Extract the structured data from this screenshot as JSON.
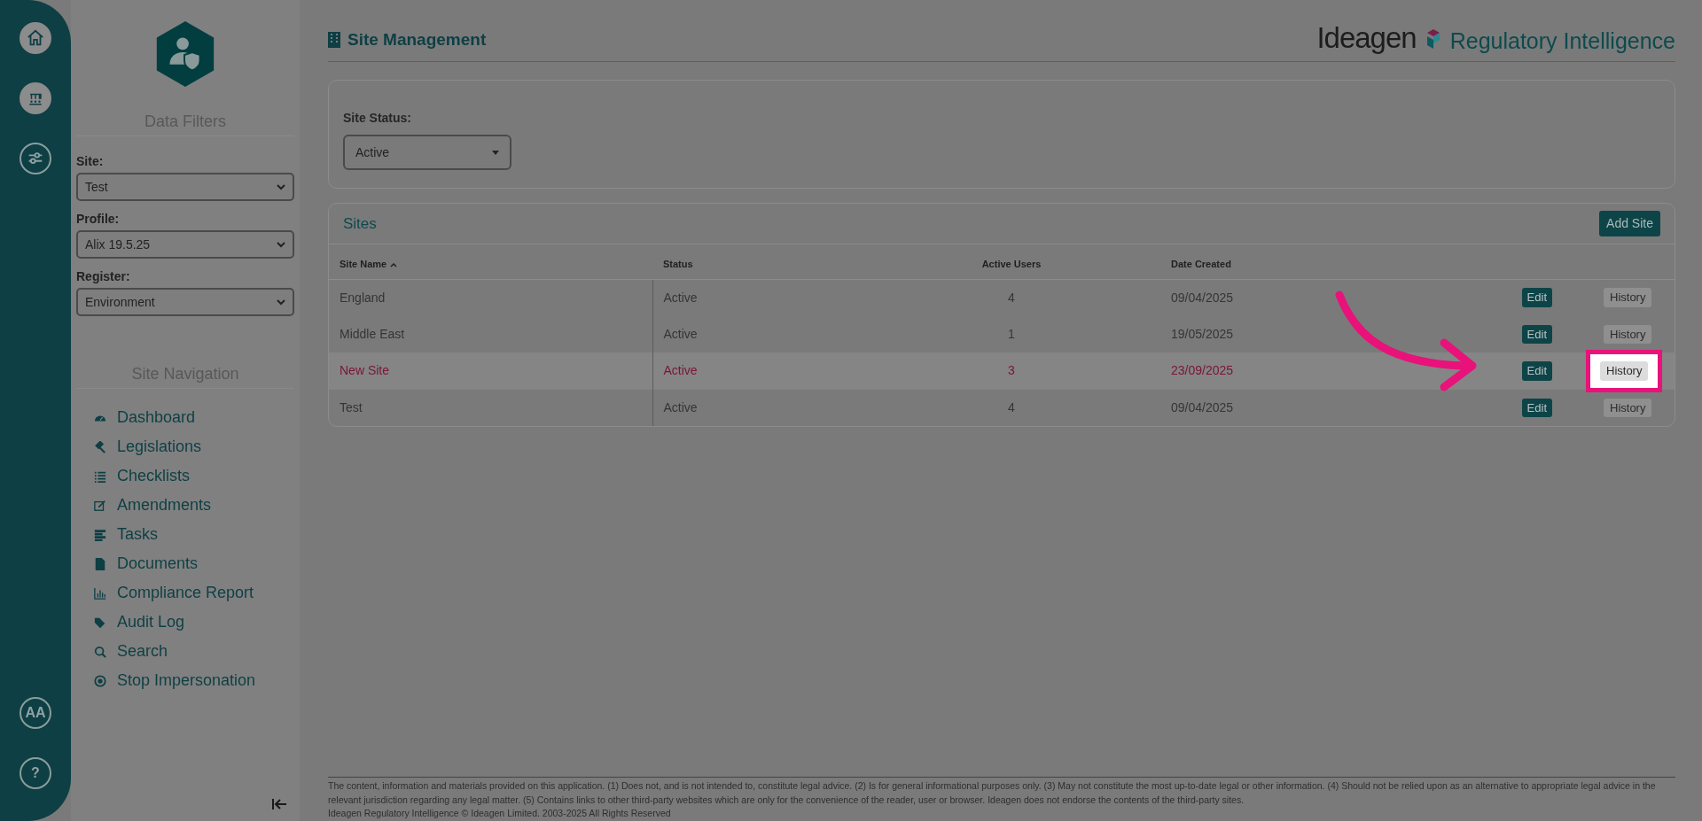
{
  "rail": {
    "avatar": "AA",
    "help": "?"
  },
  "sidebar": {
    "filters_title": "Data Filters",
    "filters": [
      {
        "label": "Site:",
        "value": "Test"
      },
      {
        "label": "Profile:",
        "value": "Alix 19.5.25"
      },
      {
        "label": "Register:",
        "value": "Environment"
      }
    ],
    "nav_title": "Site Navigation",
    "nav": [
      {
        "label": "Dashboard",
        "kind": "gauge"
      },
      {
        "label": "Legislations",
        "kind": "gavel"
      },
      {
        "label": "Checklists",
        "kind": "list"
      },
      {
        "label": "Amendments",
        "kind": "edit"
      },
      {
        "label": "Tasks",
        "kind": "tasks"
      },
      {
        "label": "Documents",
        "kind": "file"
      },
      {
        "label": "Compliance Report",
        "kind": "chart"
      },
      {
        "label": "Audit Log",
        "kind": "tags"
      },
      {
        "label": "Search",
        "kind": "search"
      },
      {
        "label": "Stop Impersonation",
        "kind": "stop"
      }
    ]
  },
  "page_title": "Site Management",
  "logo": {
    "brand": "Ideagen",
    "product": "Regulatory Intelligence"
  },
  "status_filter": {
    "label": "Site Status:",
    "value": "Active"
  },
  "sites": {
    "title": "Sites",
    "add_button": "Add Site",
    "columns": [
      {
        "label": "Site Name",
        "sorted": true
      },
      {
        "label": "Status",
        "sorted": false
      },
      {
        "label": "Active Users",
        "sorted": false
      },
      {
        "label": "Date Created",
        "sorted": false
      }
    ],
    "rows": [
      {
        "cells": [
          "England",
          "Active",
          "4",
          "09/04/2025"
        ],
        "edit": "Edit",
        "history": "History",
        "selected": false,
        "spotlight": false
      },
      {
        "cells": [
          "Middle East",
          "Active",
          "1",
          "19/05/2025"
        ],
        "edit": "Edit",
        "history": "History",
        "selected": false,
        "spotlight": false
      },
      {
        "cells": [
          "New Site",
          "Active",
          "3",
          "23/09/2025"
        ],
        "edit": "Edit",
        "history": "History",
        "selected": true,
        "spotlight": true
      },
      {
        "cells": [
          "Test",
          "Active",
          "4",
          "09/04/2025"
        ],
        "edit": "Edit",
        "history": "History",
        "selected": false,
        "spotlight": false
      }
    ]
  },
  "footer": {
    "disclaimer": "The content, information and materials provided on this application. (1) Does not, and is not intended to, constitute legal advice. (2) Is for general informational purposes only. (3) May not constitute the most up-to-date legal or other information. (4) Should not be relied upon as an alternative to appropriate legal advice in the relevant jurisdiction regarding any legal matter. (5) Contains links to other third-party websites which are only for the convenience of the reader, user or browser. Ideagen does not endorse the contents of the third-party sites.",
    "copyright": "Ideagen Regulatory Intelligence © Ideagen Limited. 2003-2025 All Rights Reserved"
  }
}
